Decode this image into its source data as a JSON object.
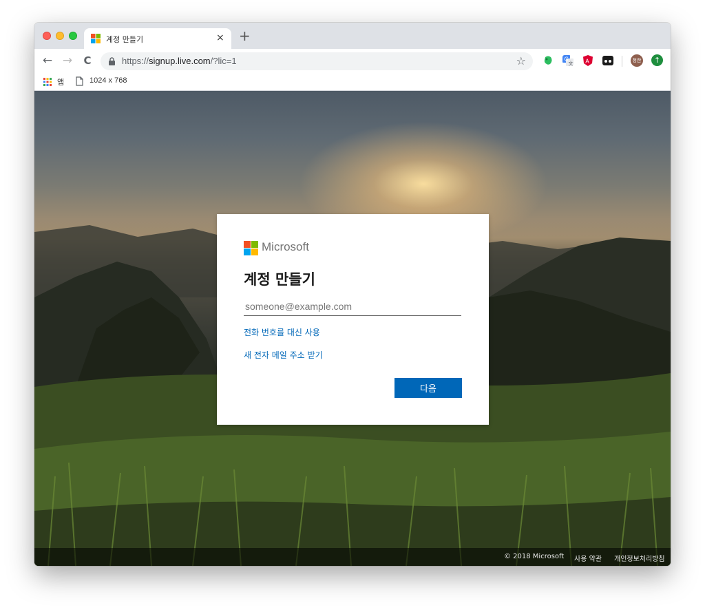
{
  "tab": {
    "title": "계정 만들기",
    "close": "×",
    "new_tab": "+"
  },
  "toolbar": {
    "back": "←",
    "forward": "→",
    "reload": "C",
    "url_prefix": "https://",
    "url_host": "signup.live.com",
    "url_path": "/?lic=1",
    "star": "☆",
    "profile_initials": "정한",
    "update": "↑"
  },
  "bookmarks": {
    "apps": "앱",
    "page": "1024 x 768"
  },
  "card": {
    "brand": "Microsoft",
    "title": "계정 만들기",
    "email_placeholder": "someone@example.com",
    "link_phone": "전화 번호를 대신 사용",
    "link_new_email": "새 전자 메일 주소 받기",
    "next_button": "다음"
  },
  "footer": {
    "copyright": "© 2018 Microsoft",
    "terms": "사용 약관",
    "privacy": "개인정보처리방침"
  },
  "colors": {
    "ms_red": "#f25022",
    "ms_green": "#7fba00",
    "ms_blue": "#00a4ef",
    "ms_yellow": "#ffb900",
    "accent": "#0067b8"
  },
  "icons": [
    "apps-grid-icon",
    "page-icon",
    "lock-icon",
    "star-icon",
    "evernote-icon",
    "translate-icon",
    "angular-icon",
    "ublock-icon"
  ]
}
